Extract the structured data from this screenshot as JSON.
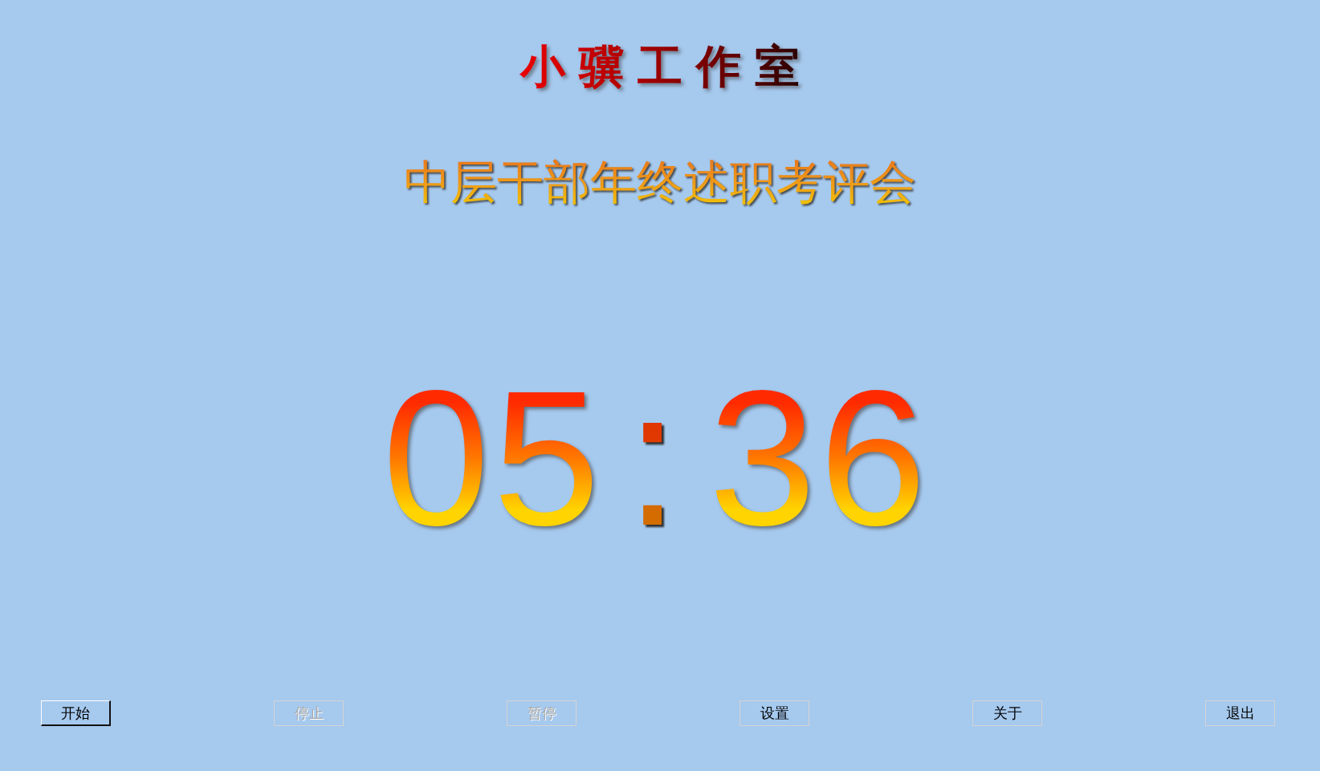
{
  "studio_title": "小骥工作室",
  "event_title": "中层干部年终述职考评会",
  "timer": {
    "minutes": "05",
    "separator": ":",
    "seconds": "36"
  },
  "buttons": [
    {
      "label": "开始",
      "disabled": false,
      "focused": true
    },
    {
      "label": "停止",
      "disabled": true,
      "focused": false
    },
    {
      "label": "暂停",
      "disabled": true,
      "focused": false
    },
    {
      "label": "设置",
      "disabled": false,
      "focused": false
    },
    {
      "label": "关于",
      "disabled": false,
      "focused": false
    },
    {
      "label": "退出",
      "disabled": false,
      "focused": false
    }
  ]
}
